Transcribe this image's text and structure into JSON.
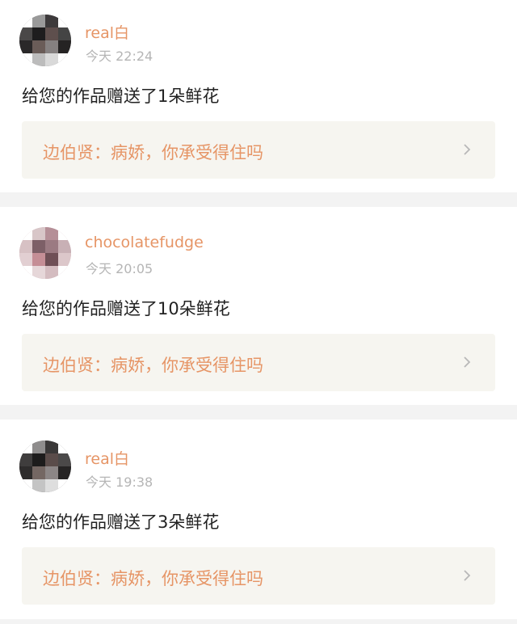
{
  "notifications": [
    {
      "username": "real白",
      "time": "今天 22:24",
      "message": "给您的作品赠送了1朵鲜花",
      "work_title": "边伯贤：病娇，你承受得住吗",
      "avatar_icon": "blurred-avatar-icon"
    },
    {
      "username": "chocolatefudge",
      "time": "今天 20:05",
      "message": "给您的作品赠送了10朵鲜花",
      "work_title": "边伯贤：病娇，你承受得住吗",
      "avatar_icon": "blurred-avatar-icon"
    },
    {
      "username": "real白",
      "time": "今天 19:38",
      "message": "给您的作品赠送了3朵鲜花",
      "work_title": "边伯贤：病娇，你承受得住吗",
      "avatar_icon": "blurred-avatar-icon"
    }
  ],
  "colors": {
    "accent": "#e69566",
    "timestamp": "#b5b5b5",
    "body_text": "#222222",
    "link_bg": "#f6f5f0",
    "separator": "#f3f3f3",
    "chevron": "#b8b8b8"
  }
}
